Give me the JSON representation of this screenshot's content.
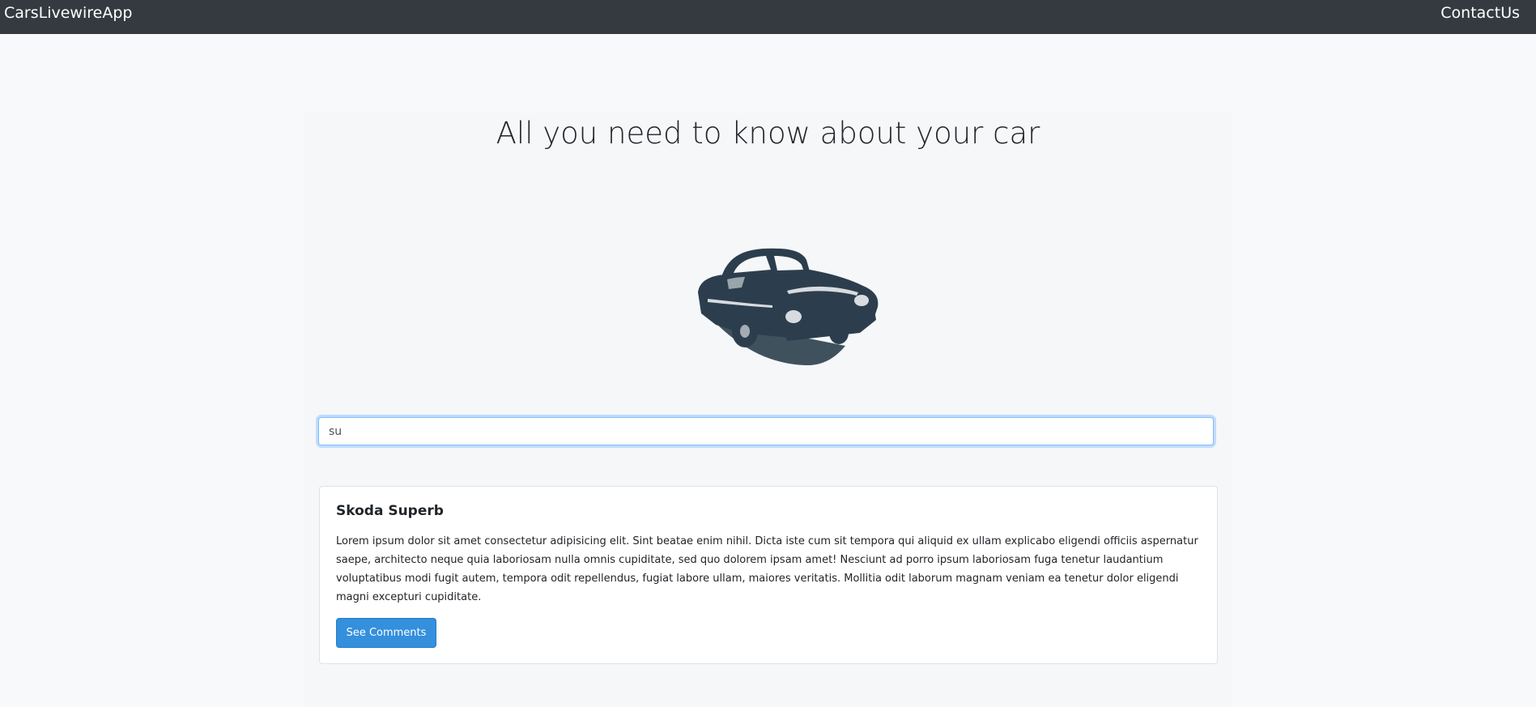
{
  "navbar": {
    "brand": "CarsLivewireApp",
    "contact_link": "ContactUs"
  },
  "hero": {
    "headline": "All you need to know about your car",
    "image_icon": "classic-car-illustration"
  },
  "search": {
    "value": "su",
    "placeholder": ""
  },
  "results": [
    {
      "title": "Skoda Superb",
      "description": "Lorem ipsum dolor sit amet consectetur adipisicing elit. Sint beatae enim nihil. Dicta iste cum sit tempora qui aliquid ex ullam explicabo eligendi officiis aspernatur saepe, architecto neque quia laboriosam nulla omnis cupiditate, sed quo dolorem ipsam amet! Nesciunt ad porro ipsum laboriosam fuga tenetur laudantium voluptatibus modi fugit autem, tempora odit repellendus, fugiat labore ullam, maiores veritatis. Mollitia odit laborum magnam veniam ea tenetur dolor eligendi magni excepturi cupiditate.",
      "button_label": "See Comments"
    }
  ],
  "colors": {
    "navbar_bg": "#343a40",
    "page_bg": "#f8f9fa",
    "primary_button": "#3490dc",
    "car_ink": "#2c3e4d"
  }
}
